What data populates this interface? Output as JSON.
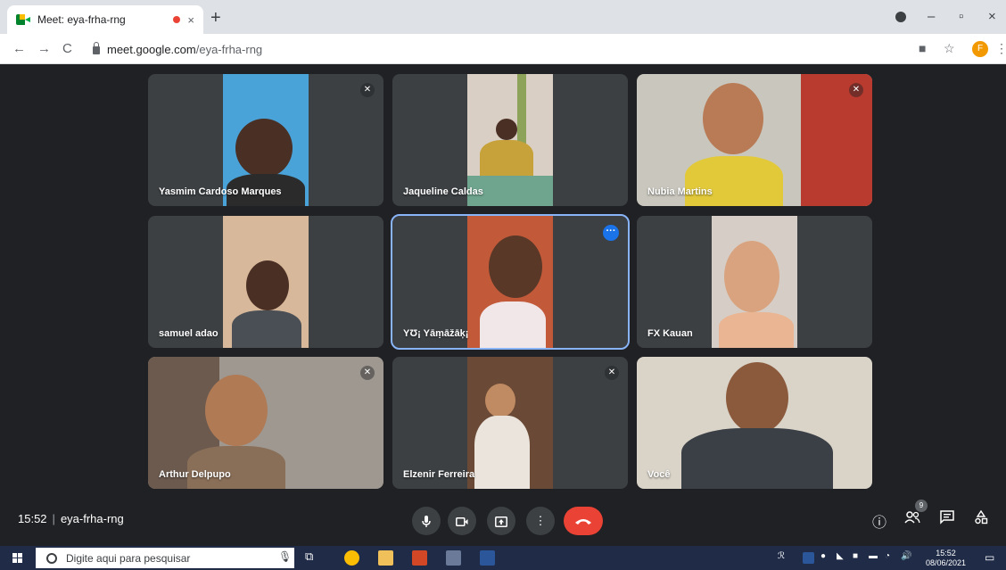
{
  "browser": {
    "tab_title": "Meet: eya-frha-rng",
    "tab_close": "×",
    "new_tab": "+",
    "url_host": "meet.google.com",
    "url_path": "/eya-frha-rng",
    "profile_initial": "F",
    "minimize": "–",
    "maximize": "▫",
    "close": "×"
  },
  "participants": [
    {
      "name": "Yasmim Cardoso Marques",
      "muted": true
    },
    {
      "name": "Jaqueline Caldas",
      "muted": false
    },
    {
      "name": "Nubia Martins",
      "muted": true
    },
    {
      "name": "samuel adao",
      "muted": false
    },
    {
      "name": "YƱ¡ Yāṃāžāķ¡",
      "muted": false,
      "active": true
    },
    {
      "name": "FX Kauan",
      "muted": false
    },
    {
      "name": "Arthur Delpupo",
      "muted": true
    },
    {
      "name": "Elzenir Ferreira",
      "muted": true
    },
    {
      "name": "Você",
      "muted": false
    }
  ],
  "meeting": {
    "time": "15:52",
    "separator": "|",
    "code": "eya-frha-rng",
    "participant_count": "9"
  },
  "taskbar": {
    "search_placeholder": "Digite aqui para pesquisar",
    "time": "15:52",
    "date": "08/06/2021"
  },
  "colors": {
    "meet_bg": "#202124",
    "tile_bg": "#3c4043",
    "end_call": "#ea4335",
    "active_outline": "#8ab4f8"
  }
}
